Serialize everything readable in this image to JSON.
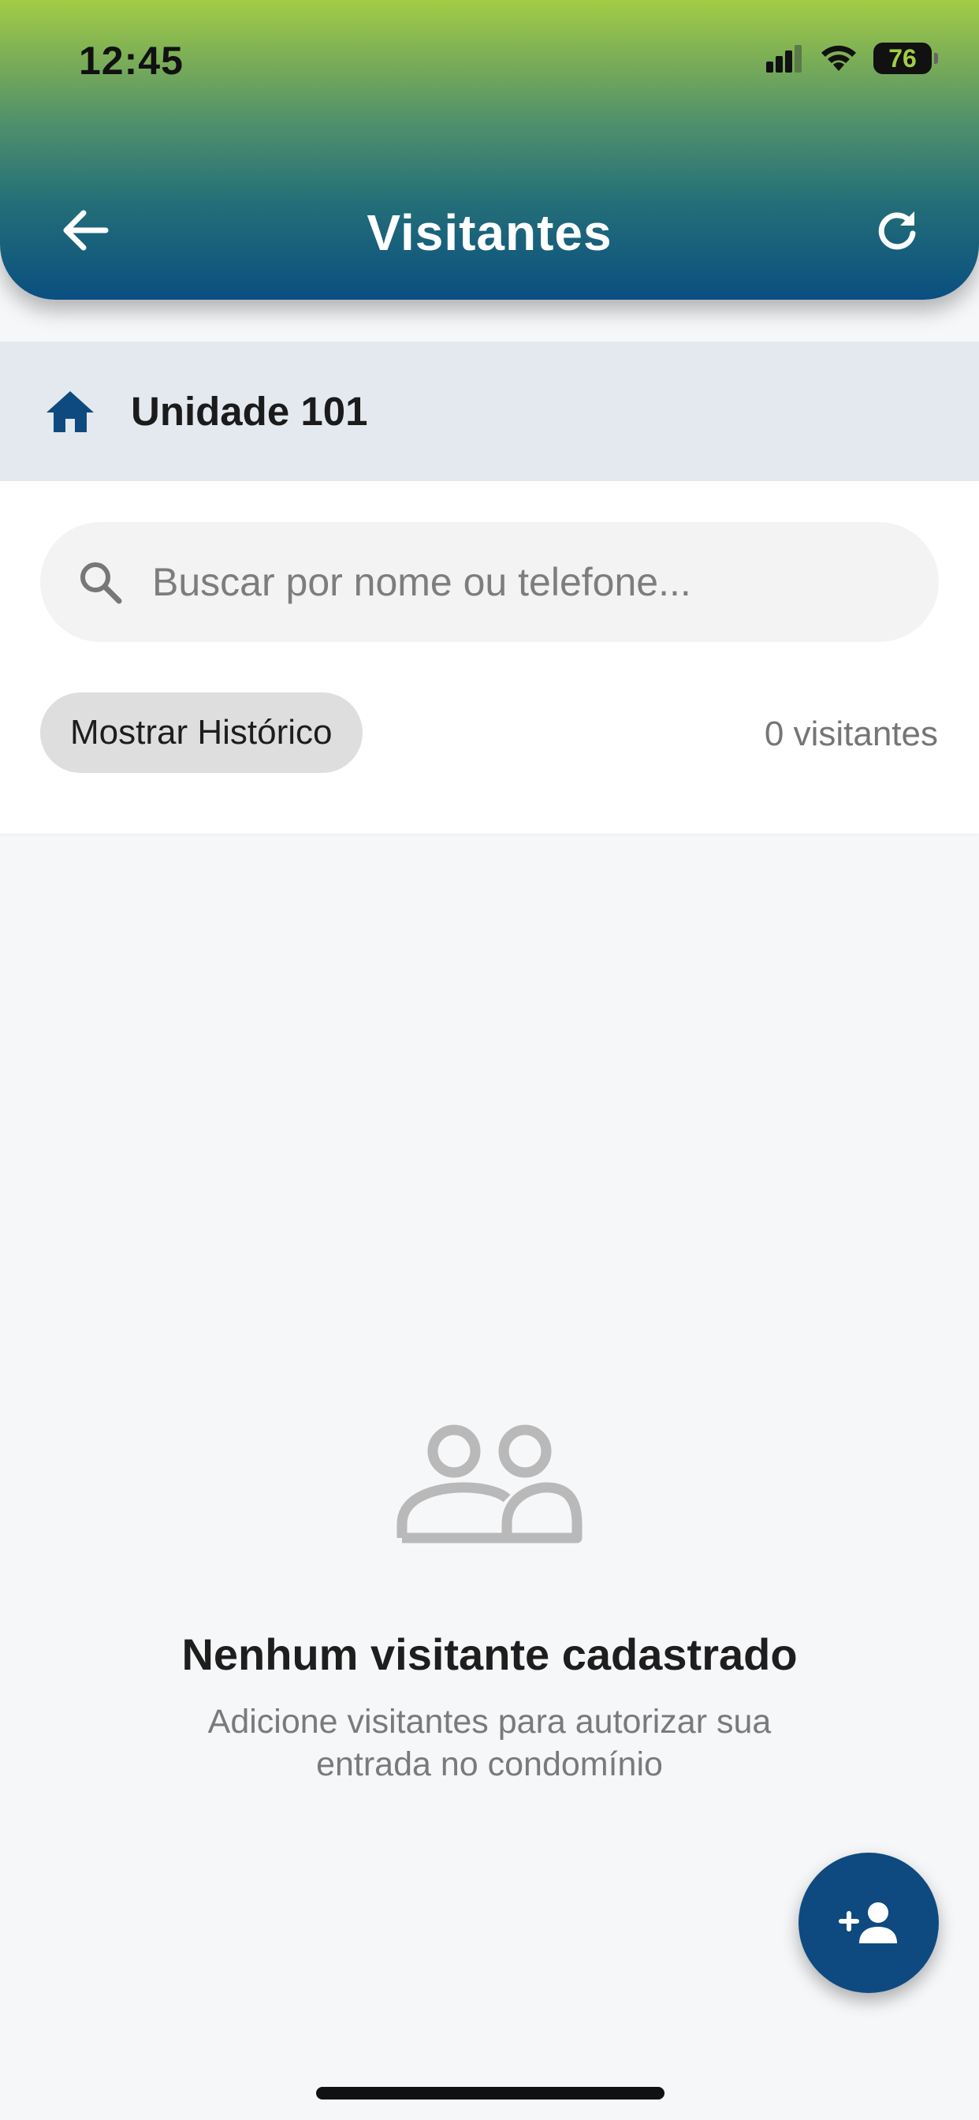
{
  "status_bar": {
    "time": "12:45",
    "battery_level": "76",
    "icons": [
      "cellular-signal-icon",
      "wifi-icon",
      "battery-icon"
    ]
  },
  "header": {
    "title": "Visitantes",
    "back_icon": "arrow-left-icon",
    "refresh_icon": "refresh-icon",
    "gradient_colors": [
      "#a2cd45",
      "#0a4f80"
    ]
  },
  "unit": {
    "icon": "home-icon",
    "label": "Unidade 101",
    "accent_color": "#0e4a80"
  },
  "search": {
    "icon": "search-icon",
    "placeholder": "Buscar por nome ou telefone...",
    "value": ""
  },
  "filters": {
    "history_label": "Mostrar Histórico",
    "count_label": "0 visitantes"
  },
  "empty_state": {
    "icon": "people-icon",
    "title": "Nenhum visitante cadastrado",
    "subtitle": "Adicione visitantes para autorizar sua entrada no condomínio"
  },
  "fab": {
    "icon": "add-person-icon",
    "color": "#0e4a80"
  }
}
